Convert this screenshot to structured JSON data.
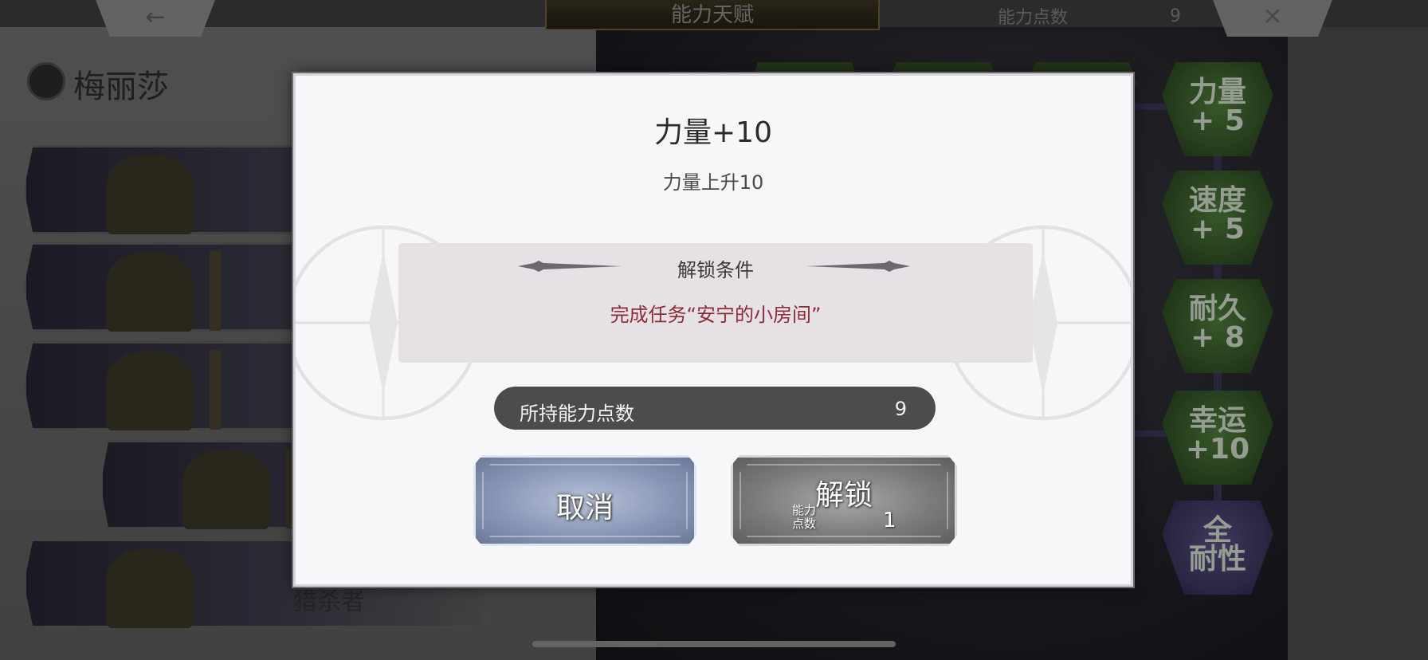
{
  "header": {
    "back_icon": "left-arrow-icon",
    "back_glyph": "←",
    "title": "能力天赋",
    "points_label": "能力点数",
    "points_value": "9",
    "close_icon": "close-x-icon",
    "close_glyph": "✕"
  },
  "character": {
    "name": "梅丽莎",
    "job_label": "猎杀者"
  },
  "board_nodes": [
    {
      "line1": "力量",
      "line2": "+ 5"
    },
    {
      "line1": "速度",
      "line2": "+ 5"
    },
    {
      "line1": "耐久",
      "line2": "+ 8"
    },
    {
      "line1": "幸运",
      "line2": "+10"
    },
    {
      "line1": "全",
      "line2": "耐性"
    }
  ],
  "dialog": {
    "title": "力量+10",
    "description": "力量上升10",
    "condition_title": "解锁条件",
    "condition_text": "完成任务“安宁的小房间”",
    "owned_points_label": "所持能力点数",
    "owned_points_value": "9",
    "cancel_label": "取消",
    "unlock_label": "解锁",
    "cost_label_line1": "能力",
    "cost_label_line2": "点数",
    "cost_value": "1"
  },
  "colors": {
    "condition_text": "#8e2a3a",
    "modal_bg": "#f7f6f9",
    "points_bar": "#4c4c4e"
  }
}
